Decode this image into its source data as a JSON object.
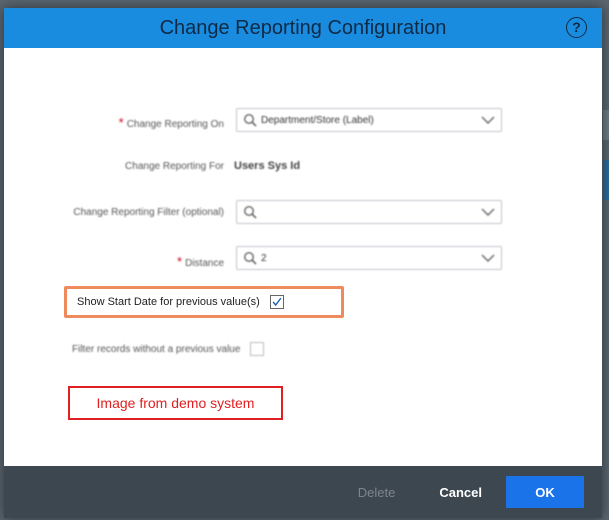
{
  "dialog": {
    "title": "Change Reporting Configuration",
    "help_glyph": "?"
  },
  "form": {
    "change_on_label": "Change Reporting On",
    "change_on_value": "Department/Store (Label)",
    "change_for_label": "Change Reporting For",
    "change_for_value": "Users Sys Id",
    "filter_label": "Change Reporting Filter (optional)",
    "filter_value": "",
    "distance_label": "Distance",
    "distance_value": "2",
    "show_start_label": "Show Start Date for previous value(s)",
    "show_start_checked": true,
    "filter_records_label": "Filter records without a previous value",
    "filter_records_checked": false
  },
  "annotation": {
    "note": "Image from demo system",
    "highlight_color": "#ee8a5c",
    "note_color": "#e02020"
  },
  "footer": {
    "delete_label": "Delete",
    "cancel_label": "Cancel",
    "ok_label": "OK"
  },
  "colors": {
    "titlebar": "#1a8ce0",
    "footer": "#3d4750",
    "ok_button": "#1a73e8"
  }
}
